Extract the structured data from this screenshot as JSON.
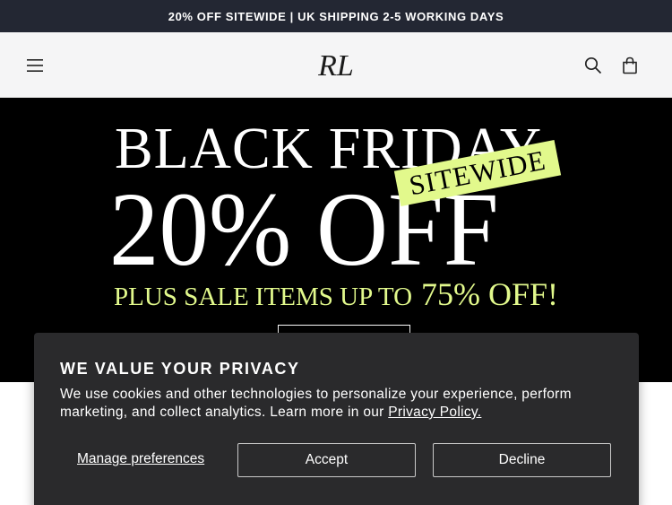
{
  "announcement": {
    "text": "20% OFF SITEWIDE | UK SHIPPING 2-5 WORKING DAYS"
  },
  "header": {
    "logo_text": "RL",
    "icons": [
      "menu-icon",
      "search-icon",
      "cart-icon"
    ]
  },
  "hero": {
    "line1": "BLACK FRIDAY",
    "line2": "20% OFF",
    "badge": "SITEWIDE",
    "line3_prefix": "PLUS SALE ITEMS UP TO",
    "line3_highlight": "75% OFF!",
    "accent_color": "#e2f98c"
  },
  "cookie_banner": {
    "title": "WE VALUE YOUR PRIVACY",
    "body": "We use cookies and other technologies to personalize your experience, perform marketing, and collect analytics. Learn more in our ",
    "policy_link": "Privacy Policy.",
    "manage_label": "Manage preferences",
    "accept_label": "Accept",
    "decline_label": "Decline"
  }
}
